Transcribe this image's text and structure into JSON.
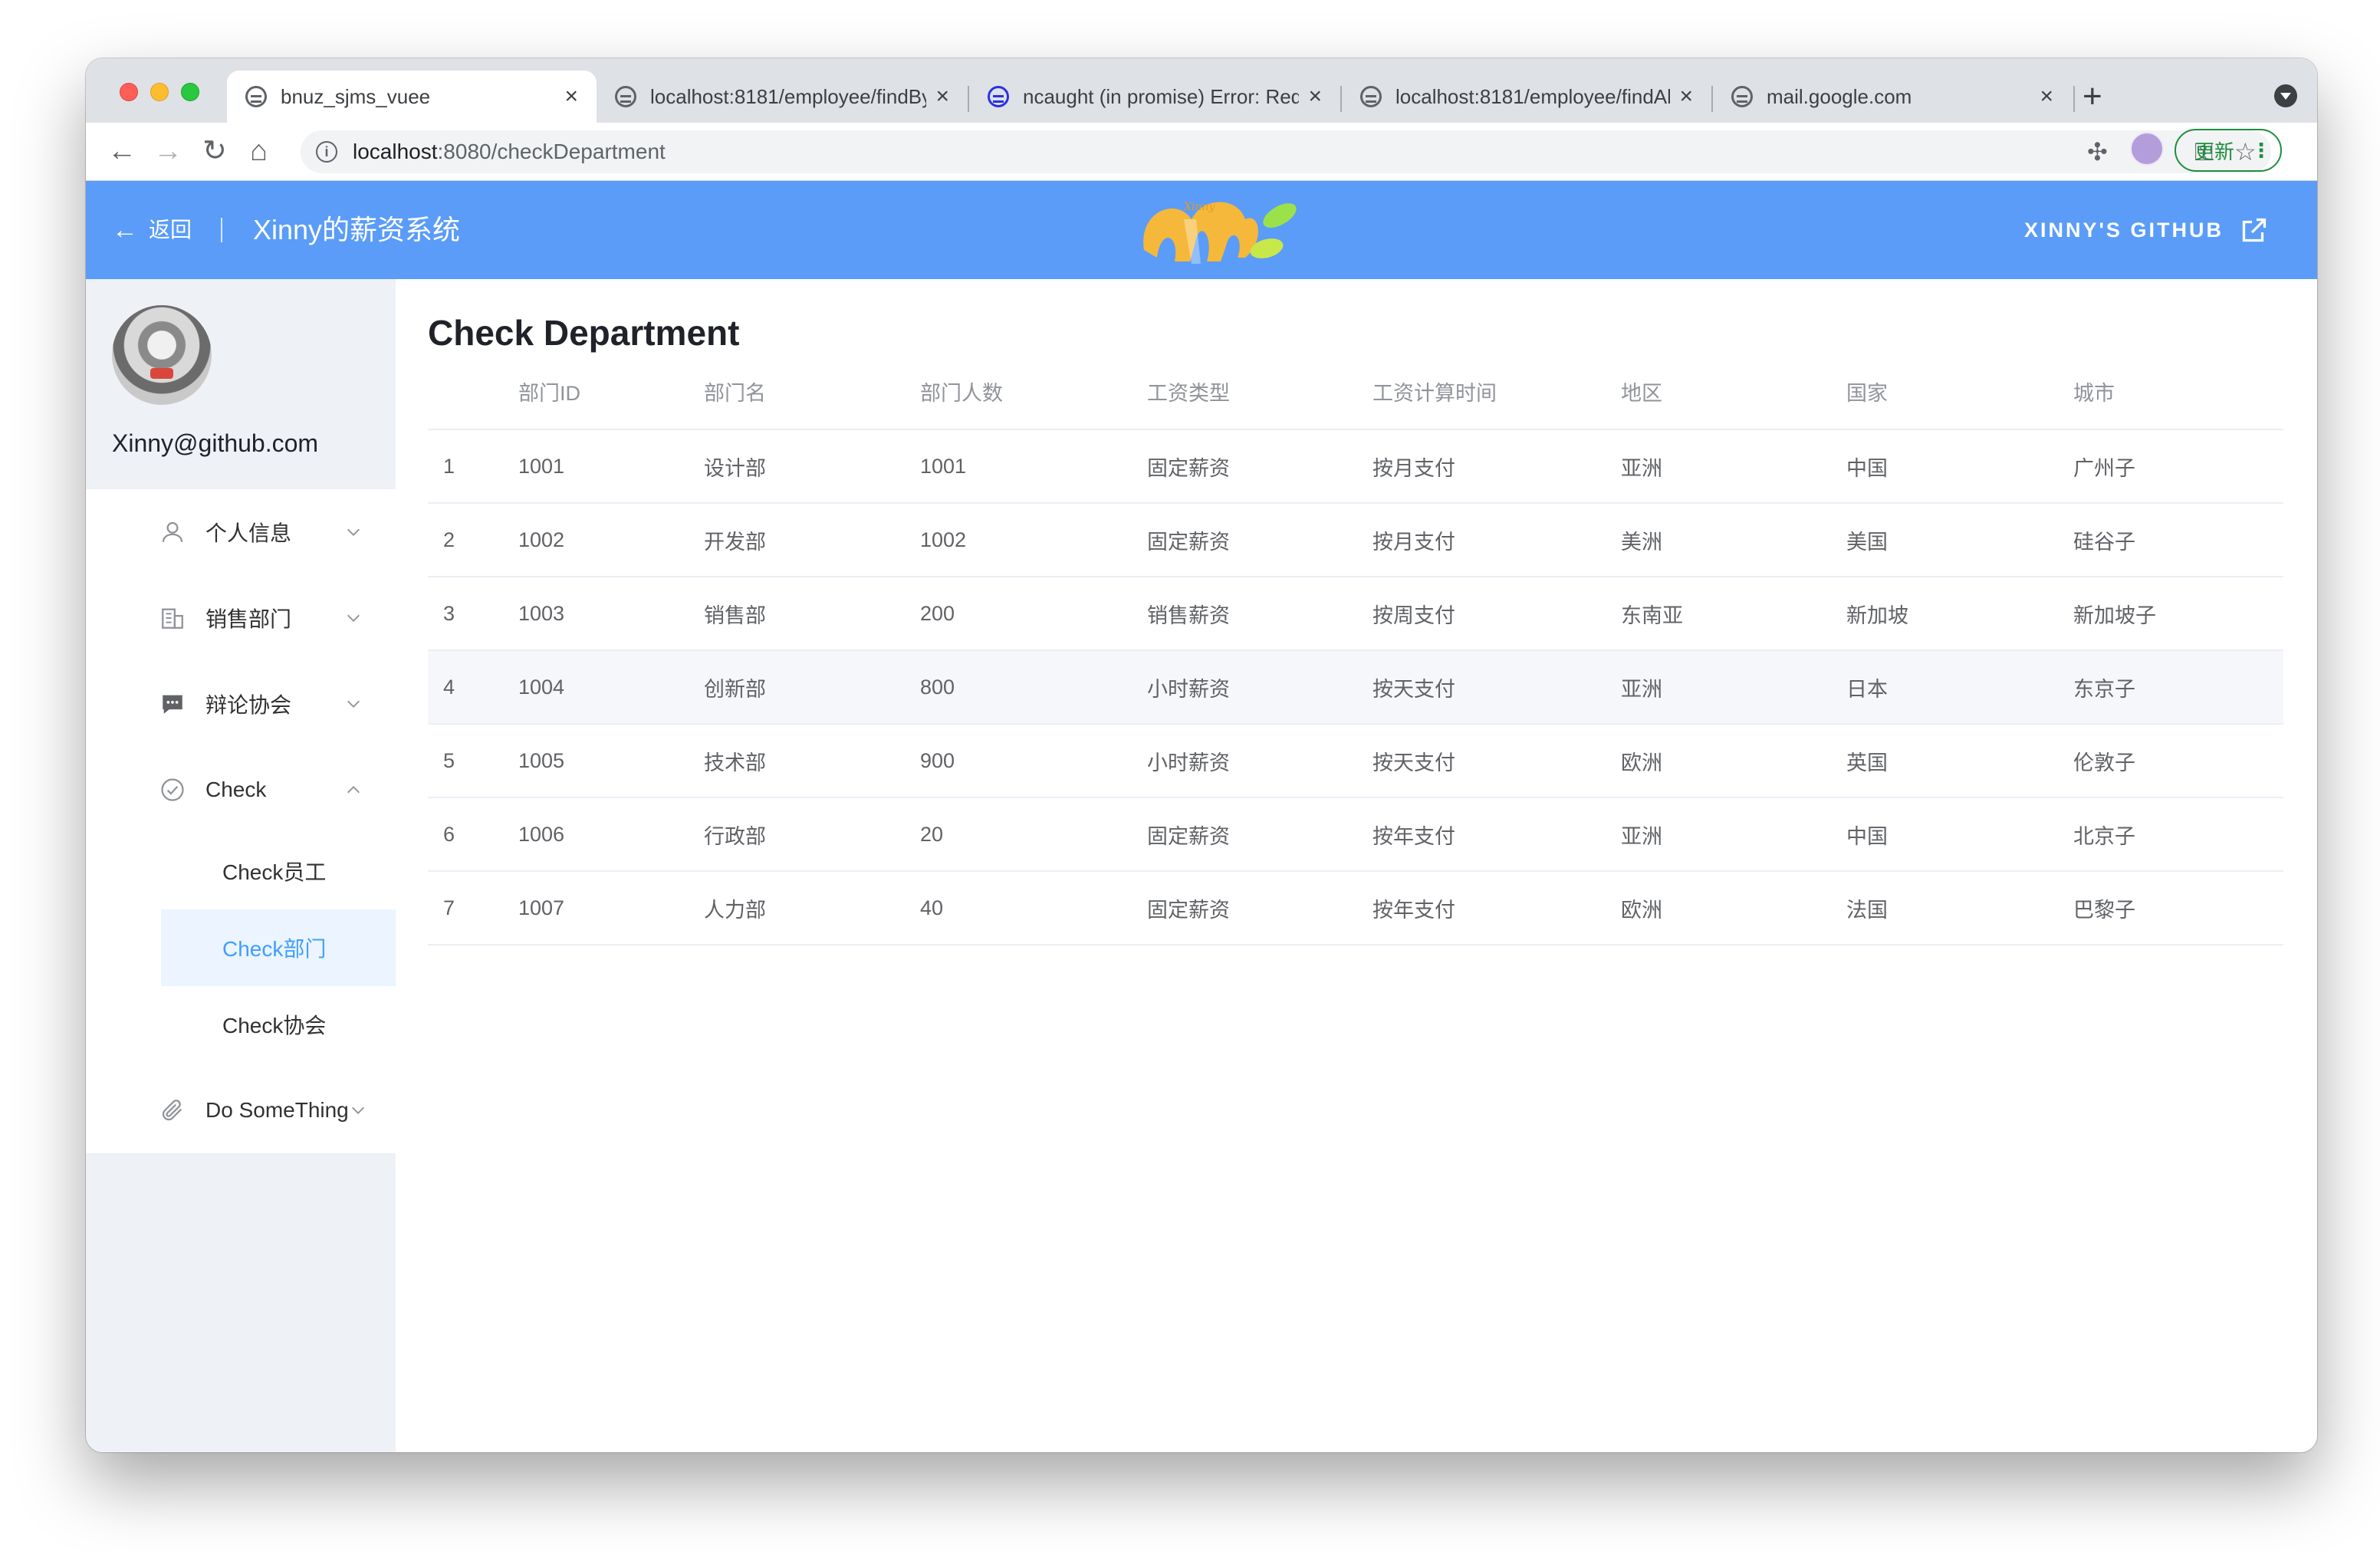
{
  "browser": {
    "tabs": [
      {
        "title": "bnuz_sjms_vuee",
        "active": true,
        "icon": "globe-icon"
      },
      {
        "title": "localhost:8181/employee/findBy",
        "active": false,
        "icon": "globe-icon"
      },
      {
        "title": "ncaught (in promise) Error: Red",
        "active": false,
        "icon": "baidu-paw-icon"
      },
      {
        "title": "localhost:8181/employee/findAll",
        "active": false,
        "icon": "globe-icon"
      },
      {
        "title": "mail.google.com",
        "active": false,
        "icon": "globe-icon"
      }
    ],
    "url_host": "localhost",
    "url_path": ":8080/checkDepartment",
    "update_label": "更新"
  },
  "header": {
    "back_label": "返回",
    "app_title": "Xinny的薪资系统",
    "github_label": "XINNY'S GITHUB",
    "logo_text": "Xinny",
    "color": "#5a9cf8"
  },
  "sidebar": {
    "email": "Xinny@github.com",
    "menu": [
      {
        "label": "个人信息",
        "icon": "user-icon",
        "expanded": false
      },
      {
        "label": "销售部门",
        "icon": "building-icon",
        "expanded": false
      },
      {
        "label": "辩论协会",
        "icon": "chat-icon",
        "expanded": false
      },
      {
        "label": "Check",
        "icon": "check-circle-icon",
        "expanded": true
      },
      {
        "label": "Do SomeThing",
        "icon": "paperclip-icon",
        "expanded": false
      }
    ],
    "submenu": [
      {
        "label": "Check员工",
        "active": false
      },
      {
        "label": "Check部门",
        "active": true
      },
      {
        "label": "Check协会",
        "active": false
      }
    ],
    "active_color": "#409eff"
  },
  "main": {
    "title": "Check Department",
    "columns": [
      "",
      "部门ID",
      "部门名",
      "部门人数",
      "工资类型",
      "工资计算时间",
      "地区",
      "国家",
      "城市"
    ],
    "rows": [
      [
        "1",
        "1001",
        "设计部",
        "1001",
        "固定薪资",
        "按月支付",
        "亚洲",
        "中国",
        "广州子"
      ],
      [
        "2",
        "1002",
        "开发部",
        "1002",
        "固定薪资",
        "按月支付",
        "美洲",
        "美国",
        "硅谷子"
      ],
      [
        "3",
        "1003",
        "销售部",
        "200",
        "销售薪资",
        "按周支付",
        "东南亚",
        "新加坡",
        "新加坡子"
      ],
      [
        "4",
        "1004",
        "创新部",
        "800",
        "小时薪资",
        "按天支付",
        "亚洲",
        "日本",
        "东京子"
      ],
      [
        "5",
        "1005",
        "技术部",
        "900",
        "小时薪资",
        "按天支付",
        "欧洲",
        "英国",
        "伦敦子"
      ],
      [
        "6",
        "1006",
        "行政部",
        "20",
        "固定薪资",
        "按年支付",
        "亚洲",
        "中国",
        "北京子"
      ],
      [
        "7",
        "1007",
        "人力部",
        "40",
        "固定薪资",
        "按年支付",
        "欧洲",
        "法国",
        "巴黎子"
      ]
    ],
    "hover_row": 3
  }
}
